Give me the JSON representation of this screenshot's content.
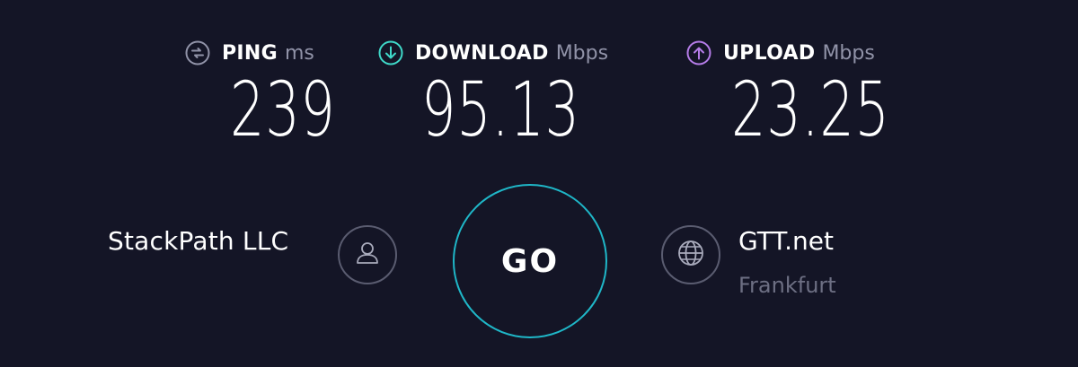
{
  "metrics": {
    "ping": {
      "label": "PING",
      "unit": "ms",
      "value": "239",
      "icon": "ping-icon",
      "color": "#9193a8"
    },
    "download": {
      "label": "DOWNLOAD",
      "unit": "Mbps",
      "value": "95.13",
      "icon": "download-arrow-icon",
      "color": "#3fd9c9"
    },
    "upload": {
      "label": "UPLOAD",
      "unit": "Mbps",
      "value": "23.25",
      "icon": "upload-arrow-icon",
      "color": "#b57ce8"
    }
  },
  "isp": {
    "name": "StackPath LLC",
    "icon": "user-icon"
  },
  "go_button": {
    "label": "GO",
    "color": "#1fb7c8"
  },
  "server": {
    "name": "GTT.net",
    "location": "Frankfurt",
    "icon": "globe-icon"
  },
  "colors": {
    "background": "#141526",
    "muted_text": "#6d6f83",
    "circle_border": "#5a5c70"
  }
}
